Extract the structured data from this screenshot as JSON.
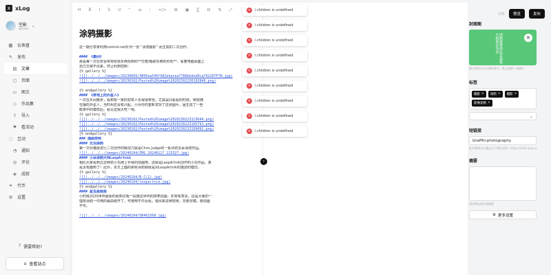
{
  "app": {
    "logo_letter": "x",
    "name": "xLog"
  },
  "user": {
    "name": "空影",
    "handle": "@kazil",
    "chevron": "⌄"
  },
  "nav": [
    {
      "icon": "▦",
      "label": "仪表盘",
      "sub": false
    },
    {
      "icon": "✎",
      "label": "发布",
      "sub": false
    },
    {
      "icon": "▤",
      "label": "文章",
      "sub": true,
      "active": true
    },
    {
      "icon": "▢",
      "label": "页面",
      "sub": true
    },
    {
      "icon": "▭",
      "label": "图文",
      "sub": true
    },
    {
      "icon": "◇",
      "label": "作品集",
      "sub": true
    },
    {
      "icon": "⇩",
      "label": "导入",
      "sub": true
    },
    {
      "icon": "⚑",
      "label": "看活动",
      "sub": true
    },
    {
      "icon": "◌",
      "label": "互动",
      "sub": false
    },
    {
      "icon": "◔",
      "label": "通知",
      "sub": true
    },
    {
      "icon": "◎",
      "label": "评论",
      "sub": true
    },
    {
      "icon": "◈",
      "label": "成就",
      "sub": true
    },
    {
      "icon": "⚭",
      "label": "代币",
      "sub": false
    },
    {
      "icon": "⚙",
      "label": "设置",
      "sub": false
    }
  ],
  "help": {
    "icon": "?",
    "label": "需要帮助?"
  },
  "view_site": {
    "icon": "⌂",
    "label": "查看站点"
  },
  "toolbar": [
    "H",
    "B",
    "I",
    "S",
    "U",
    "“",
    "≡",
    "⁝",
    "</>",
    "⊞",
    "▣",
    "∑",
    "⊟",
    "⇅",
    "⤢"
  ],
  "top": {
    "status": "字数",
    "preview": "预览",
    "publish": "发布"
  },
  "post": {
    "title": "涂鸦摄影"
  },
  "editor_lines": [
    {
      "t": "这一期分享家利用control-net针对一张 “涂鸦摄影” 而生成的二次创作。",
      "c": "cn"
    },
    {
      "t": "",
      "c": ""
    },
    {
      "t": "#### 《墨间》",
      "c": "h"
    },
    {
      "t": "那是每一次在安谷常常收拾东西找到的**打磨/唱歌东西的秒轮**，看着电脑桌面上",
      "c": "cn"
    },
    {
      "t": "自己又做不出来，然让利用控制：",
      "c": "cn"
    },
    {
      "t": "{% gallery %}",
      "c": ""
    },
    {
      "t": "![](../../../images/20230609/3B05ea546f982ebacea7788bbded0ca742207F7B.jpg)",
      "c": "link"
    },
    {
      "t": "![](../../../images/20230102/Pasted%20image%20202302230102846.png)",
      "c": "link"
    },
    {
      "t": "",
      "c": ""
    },
    {
      "t": "{% endgallery %}",
      "c": ""
    },
    {
      "t": "#### 《草地上的外星人》",
      "c": "h"
    },
    {
      "t": "一次在乡间散步，看到有一家的初草人长得很奇怪，尤其是同看看的时候，特效拥",
      "c": "cn"
    },
    {
      "t": "在摆的外星人，当时AI还没有兴起，六月份的重新发现了这张图片，猛生成了一些",
      "c": "cn"
    },
    {
      "t": "概率中的模样后，看见这我大吃一惊。",
      "c": "cn"
    },
    {
      "t": "{% gallery %}",
      "c": ""
    },
    {
      "t": "![](../../../images/20230102/Pasted%20image%20202302231C9644.png)",
      "c": "link"
    },
    {
      "t": "![](../../../images/20230102/Pasted%20image%20202302231D5791.png)",
      "c": "link"
    },
    {
      "t": "![](../../../images/20230102/Pasted%20image%20202302231D9692.png)",
      "c": "link"
    },
    {
      "t": "{% endgallery %}",
      "c": ""
    },
    {
      "t": "### 插曲举例",
      "c": "h"
    },
    {
      "t": "#### 云羽涂鸦",
      "c": "h"
    },
    {
      "t": "第一次对猫崽进行二次创作的概动力就是Chris Judge的一系列的云朵涂鸦作品。",
      "c": "cn"
    },
    {
      "t": "![](../../../images/20240104/IMG_20240117_223327.jpg)",
      "c": "link"
    },
    {
      "t": "#### 小朵涂鸦大师LeopArtnik",
      "c": "h"
    },
    {
      "t": "相比大家看到过这种抓小鸟随上手臂的动画吧，这就是LeopArtnik创作的小鸟作品，真",
      "c": "cn"
    },
    {
      "t": "是太有趣到了！此外，本文上面的那些涂鸦我就是对LeopArtnik的描述的模仿。",
      "c": "cn"
    },
    {
      "t": "{% gallery %}",
      "c": ""
    },
    {
      "t": "![](../../../images/20240104/B-C(2).jpg)",
      "c": "link"
    },
    {
      "t": "![](../../../images/20240104/leopartnik.jpg)",
      "c": "link"
    },
    {
      "t": "{% endgallery %}",
      "c": ""
    },
    {
      "t": "#### 星虫是她恩",
      "c": "h"
    },
    {
      "t": "小时候2020世界最受的就知识我一段做这世界的搞笑动画，非常有意思。这是大量的一",
      "c": "cn"
    },
    {
      "t": "理想涂鸦一件用的最由级开了，可使用不中及看，值出来这种效果，非要非模，要动画",
      "c": "cn"
    },
    {
      "t": "不可。",
      "c": "cn"
    },
    {
      "t": "",
      "c": ""
    },
    {
      "t": "![](../../../images/20240104/5B463368.jpg)",
      "c": "link"
    }
  ],
  "toast_message": "i.children is undefined",
  "toast_count": 9,
  "arrow": "›",
  "right": {
    "cover_label": "封面图",
    "cover_text": "涂鸦是我的无言但有力的表达方式",
    "cover_close": "×",
    "cover_hint": "图片将显示在文章列表中，默认取第一张图片",
    "tags_label": "标签",
    "tags": [
      "摄影",
      "涂鸦",
      "摄影",
      "影像涂鸦"
    ],
    "slug_label": "短链接",
    "slug_value": "Graffiti-photography",
    "slug_hint": "此文章将可以通过以下地址访问：https://kazil.xlog.app/Graffiti-photography",
    "summary_label": "摘要",
    "summary_hint": "留空将自动生成摘要",
    "more_label": "更多设置",
    "more_icon": "⚙"
  },
  "colors": {
    "accent": "#111111",
    "cover": "#58c878",
    "error": "#e5484d",
    "link": "#2b54d6"
  }
}
